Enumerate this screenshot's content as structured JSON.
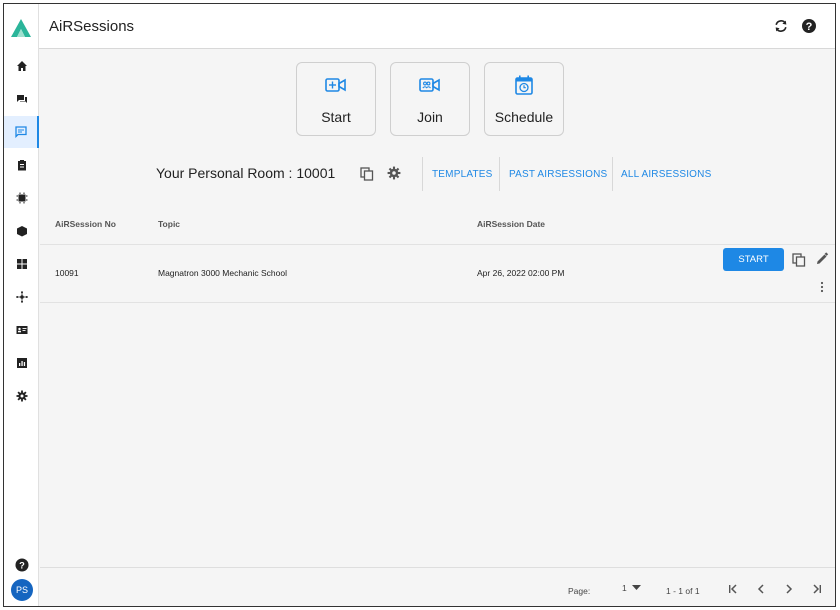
{
  "header": {
    "title": "AiRSessions"
  },
  "sidebar": {
    "items": [
      {
        "icon": "home-icon"
      },
      {
        "icon": "chat-icon"
      },
      {
        "icon": "message-icon"
      },
      {
        "icon": "clipboard-icon"
      },
      {
        "icon": "chip-icon"
      },
      {
        "icon": "cube-icon"
      },
      {
        "icon": "dashboard-icon"
      },
      {
        "icon": "network-icon"
      },
      {
        "icon": "id-card-icon"
      },
      {
        "icon": "report-icon"
      },
      {
        "icon": "settings-icon"
      }
    ],
    "help_icon": "help-icon",
    "avatar_initials": "PS"
  },
  "actions": {
    "start_label": "Start",
    "join_label": "Join",
    "schedule_label": "Schedule"
  },
  "room": {
    "label": "Your Personal Room : 10001",
    "tabs": [
      "TEMPLATES",
      "PAST AIRSESSIONS",
      "ALL AIRSESSIONS"
    ]
  },
  "table": {
    "columns": [
      "AiRSession No",
      "Topic",
      "AiRSession Date"
    ],
    "rows": [
      {
        "no": "10091",
        "topic": "Magnatron 3000 Mechanic School",
        "date": "Apr 26, 2022 02:00 PM",
        "action": "START"
      }
    ]
  },
  "footer": {
    "page_label": "Page:",
    "page_value": "1",
    "range": "1 - 1 of 1"
  },
  "colors": {
    "accent": "#1e88e5",
    "logo": "#2bb59a",
    "avatar": "#1565c0"
  }
}
